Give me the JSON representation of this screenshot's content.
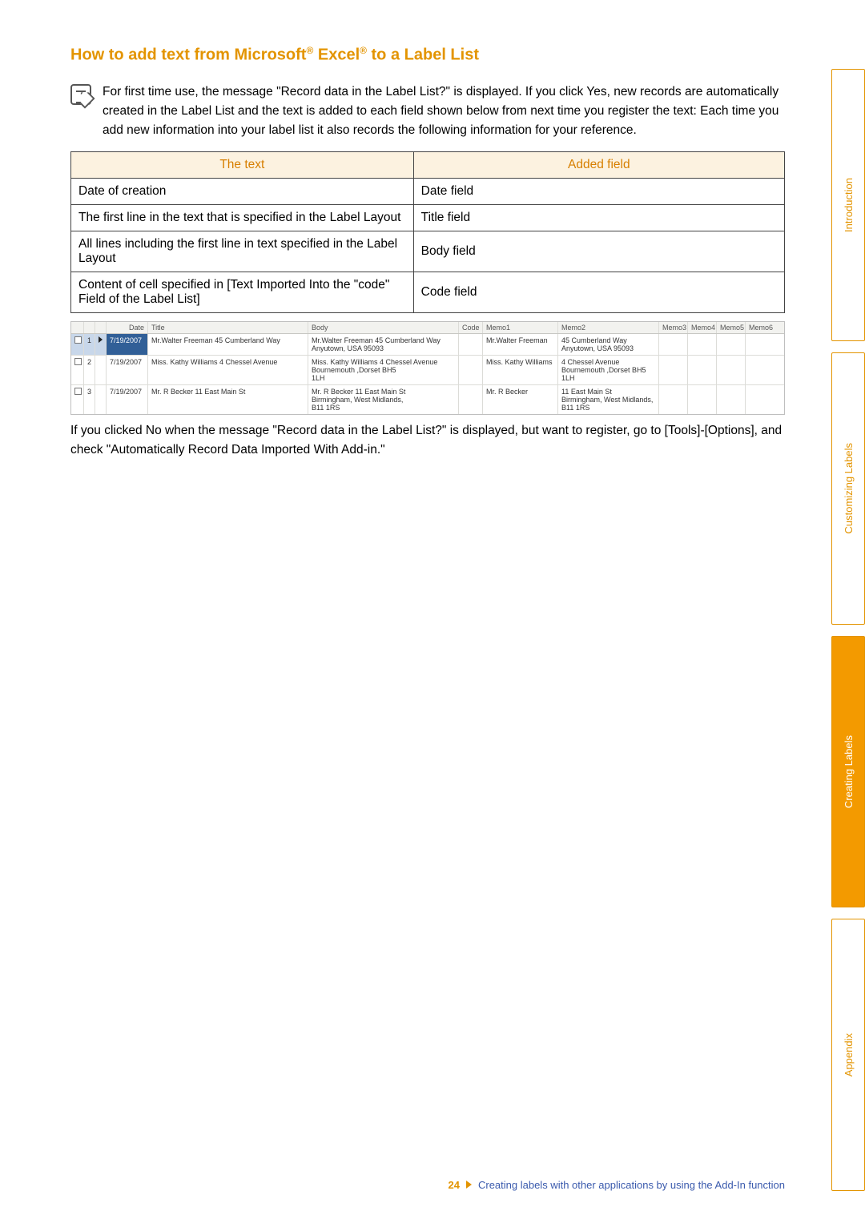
{
  "heading": {
    "prefix": "How to add text from Microsoft",
    "mid": " Excel",
    "suffix": " to a Label List",
    "reg": "®"
  },
  "note": "For first time use, the message \"Record data in the Label List?\" is displayed. If you click Yes, new records are automatically created in the Label List and the text is added to each field shown below from next time you register the text: Each time you add new information into your label list it also records the following information for your reference.",
  "fields_table": {
    "headers": [
      "The text",
      "Added field"
    ],
    "rows": [
      [
        "Date of creation",
        "Date field"
      ],
      [
        "The first line in the text that is specified in the Label Layout",
        "Title field"
      ],
      [
        "All lines including the first line in text specified in the Label Layout",
        "Body field"
      ],
      [
        "Content of cell specified in [Text Imported Into the \"code\" Field of the Label List]",
        "Code field"
      ]
    ]
  },
  "labellist": {
    "headers": {
      "date": "Date",
      "title": "Title",
      "body": "Body",
      "code": "Code",
      "memo1": "Memo1",
      "memo2": "Memo2",
      "memo3": "Memo3",
      "memo4": "Memo4",
      "memo5": "Memo5",
      "memo6": "Memo6"
    },
    "rows": [
      {
        "n": "1",
        "date": "7/19/2007",
        "title": "Mr.Walter Freeman 45 Cumberland Way",
        "body": "Mr.Walter Freeman 45 Cumberland Way\nAnyutown, USA  95093",
        "memo1": "Mr.Walter Freeman",
        "memo2": "45 Cumberland Way\nAnyutown, USA  95093",
        "selected": true
      },
      {
        "n": "2",
        "date": "7/19/2007",
        "title": "Miss. Kathy Williams 4 Chessel Avenue",
        "body": "Miss. Kathy Williams 4 Chessel Avenue\nBournemouth ,Dorset BH5\n1LH",
        "memo1": "Miss. Kathy Williams",
        "memo2": "4 Chessel Avenue\nBournemouth ,Dorset BH5\n1LH",
        "selected": false
      },
      {
        "n": "3",
        "date": "7/19/2007",
        "title": "Mr. R Becker 11 East Main St",
        "body": "Mr. R Becker 11 East Main St\nBirmingham, West Midlands,\nB11 1RS",
        "memo1": "Mr. R Becker",
        "memo2": "11 East Main St\nBirmingham, West Midlands,\nB11 1RS",
        "selected": false
      }
    ]
  },
  "para_after": "If you clicked No when the message \"Record data in the Label List?\" is displayed, but want to register, go to [Tools]-[Options], and check \"Automatically Record Data Imported With Add-in.\"",
  "tabs": [
    "Introduction",
    "Customizing Labels",
    "Creating Labels",
    "Appendix"
  ],
  "active_tab_index": 2,
  "footer": {
    "page": "24",
    "crumb": "Creating labels with other applications by using the Add-In function"
  }
}
